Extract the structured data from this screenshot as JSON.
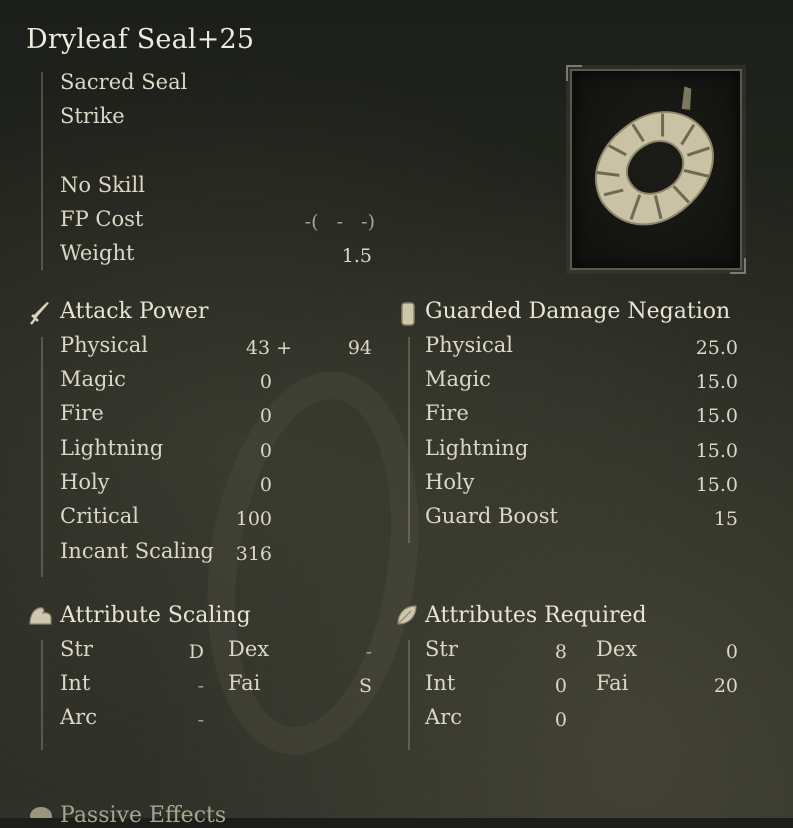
{
  "item": {
    "name": "Dryleaf Seal+25",
    "type": "Sacred Seal",
    "attack_type": "Strike",
    "skill": "No Skill",
    "fp_cost_label": "FP Cost",
    "fp_cost_value": "-(   -   -)",
    "weight_label": "Weight",
    "weight_value": "1.5"
  },
  "attack_power": {
    "title": "Attack Power",
    "rows": [
      {
        "label": "Physical",
        "base": "43 +",
        "bonus": "94"
      },
      {
        "label": "Magic",
        "base": "0",
        "bonus": ""
      },
      {
        "label": "Fire",
        "base": "0",
        "bonus": ""
      },
      {
        "label": "Lightning",
        "base": "0",
        "bonus": ""
      },
      {
        "label": "Holy",
        "base": "0",
        "bonus": ""
      },
      {
        "label": "Critical",
        "base": "100",
        "bonus": ""
      },
      {
        "label": "Incant Scaling",
        "base": "316",
        "bonus": ""
      }
    ]
  },
  "guarded": {
    "title": "Guarded Damage Negation",
    "rows": [
      {
        "label": "Physical",
        "value": "25.0"
      },
      {
        "label": "Magic",
        "value": "15.0"
      },
      {
        "label": "Fire",
        "value": "15.0"
      },
      {
        "label": "Lightning",
        "value": "15.0"
      },
      {
        "label": "Holy",
        "value": "15.0"
      },
      {
        "label": "Guard Boost",
        "value": "15"
      }
    ]
  },
  "attribute_scaling": {
    "title": "Attribute Scaling",
    "str_label": "Str",
    "str_value": "D",
    "dex_label": "Dex",
    "dex_value": "-",
    "int_label": "Int",
    "int_value": "-",
    "fai_label": "Fai",
    "fai_value": "S",
    "arc_label": "Arc",
    "arc_value": "-"
  },
  "attributes_required": {
    "title": "Attributes Required",
    "str_label": "Str",
    "str_value": "8",
    "dex_label": "Dex",
    "dex_value": "0",
    "int_label": "Int",
    "int_value": "0",
    "fai_label": "Fai",
    "fai_value": "20",
    "arc_label": "Arc",
    "arc_value": "0"
  },
  "passive": {
    "title": "Passive Effects"
  },
  "icons": {
    "attack": "sword-icon",
    "guard": "shield-icon",
    "scaling": "arm-icon",
    "required": "leaf-icon",
    "passive": "passive-icon",
    "item_image": "dryleaf-seal-image"
  }
}
